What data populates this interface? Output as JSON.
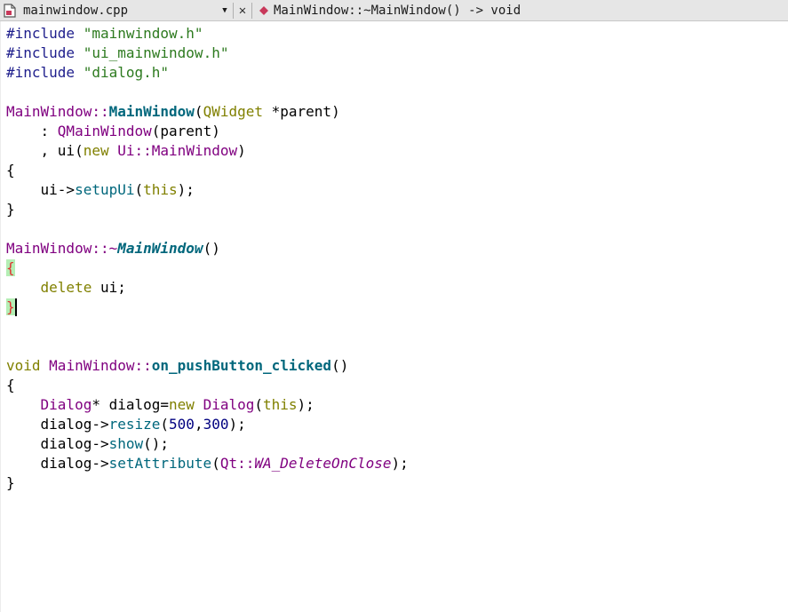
{
  "toolbar": {
    "file_name": "mainwindow.cpp",
    "symbol": "MainWindow::~MainWindow() -> void",
    "icons": [
      "file-icon",
      "dropdown-arrow-icon",
      "close-icon",
      "symbol-diamond-icon"
    ],
    "accent_color": "#c8385a"
  },
  "code": {
    "l1": {
      "a": "#include",
      "b": " ",
      "c": "\"mainwindow.h\""
    },
    "l2": {
      "a": "#include",
      "b": " ",
      "c": "\"ui_mainwindow.h\""
    },
    "l3": {
      "a": "#include",
      "b": " ",
      "c": "\"dialog.h\""
    },
    "l5": {
      "a": "MainWindow",
      "b": "::",
      "c": "MainWindow",
      "d": "(",
      "e": "QWidget",
      "f": " *parent)"
    },
    "l6": {
      "a": "    : ",
      "b": "QMainWindow",
      "c": "(parent)"
    },
    "l7": {
      "a": "    , ui(",
      "b": "new",
      "c": " ",
      "d": "Ui",
      "e": "::",
      "f": "MainWindow",
      "g": ")"
    },
    "l8": "{",
    "l9": {
      "a": "    ui->",
      "b": "setupUi",
      "c": "(",
      "d": "this",
      "e": ");"
    },
    "l10": "}",
    "l12": {
      "a": "MainWindow",
      "b": "::~",
      "c": "MainWindow",
      "d": "()"
    },
    "l13": "{",
    "l14": {
      "a": "    ",
      "b": "delete",
      "c": " ui;"
    },
    "l15": "}",
    "l18": {
      "a": "void",
      "b": " ",
      "c": "MainWindow",
      "d": "::",
      "e": "on_pushButton_clicked",
      "f": "()"
    },
    "l19": "{",
    "l20": {
      "a": "    ",
      "b": "Dialog",
      "c": "* dialog=",
      "d": "new",
      "e": " ",
      "f": "Dialog",
      "g": "(",
      "h": "this",
      "i": ");"
    },
    "l21": {
      "a": "    dialog->",
      "b": "resize",
      "c": "(",
      "d": "500",
      "e": ",",
      "f": "300",
      "g": ");"
    },
    "l22": {
      "a": "    dialog->",
      "b": "show",
      "c": "();"
    },
    "l23": {
      "a": "    dialog->",
      "b": "setAttribute",
      "c": "(",
      "d": "Qt",
      "e": "::",
      "f": "WA_DeleteOnClose",
      "g": ");"
    },
    "l24": "}"
  }
}
